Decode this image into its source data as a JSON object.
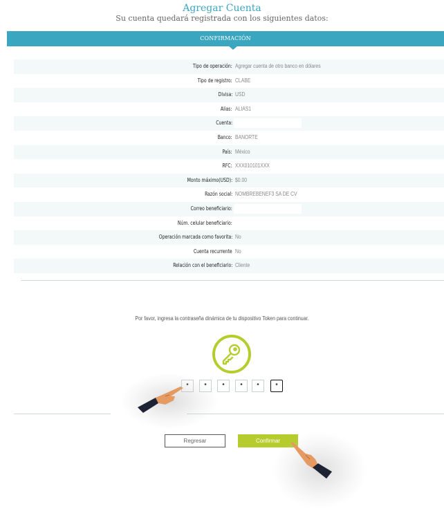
{
  "header": {
    "title": "Agregar Cuenta",
    "subtitle": "Su cuenta quedará registrada con los siguientes datos:"
  },
  "section_bar": {
    "label": "CONFIRMACIÓN"
  },
  "details": [
    {
      "label": "Tipo de operación:",
      "value": "Agregar cuenta de otro banco en dólares"
    },
    {
      "label": "Tipo de registro:",
      "value": "CLABE"
    },
    {
      "label": "Divisa:",
      "value": "USD"
    },
    {
      "label": "Alias:",
      "value": "ALIAS1"
    },
    {
      "label": "Cuenta:",
      "value": ""
    },
    {
      "label": "Banco:",
      "value": "BANORTE"
    },
    {
      "label": "País:",
      "value": "México"
    },
    {
      "label": "RFC:",
      "value": "XXX010101XXX"
    },
    {
      "label": "Monto máximo(USD):",
      "value": "$0.00"
    },
    {
      "label": "Razón social:",
      "value": "NOMBREBENEF3 SA DE CV"
    },
    {
      "label": "Correo beneficiario:",
      "value": ""
    },
    {
      "label": "Núm. celular beneficiario:",
      "value": ""
    },
    {
      "label": "Operación marcada como favorita:",
      "value": "No"
    },
    {
      "label": "Cuenta recurrente",
      "value": "No"
    },
    {
      "label": "Relación con el beneficiario:",
      "value": "Cliente"
    }
  ],
  "token": {
    "instruction": "Por favor, ingresa la contraseña dinámica de tu dispositivo Token para continuar.",
    "icon": "key-icon",
    "digits": [
      "•",
      "•",
      "•",
      "•",
      "•",
      "•"
    ]
  },
  "buttons": {
    "back_label": "Regresar",
    "confirm_label": "Confirmar"
  },
  "colors": {
    "accent": "#3ba6c0",
    "confirm": "#b6cc2c",
    "row_shade": "#f3f8f9"
  }
}
